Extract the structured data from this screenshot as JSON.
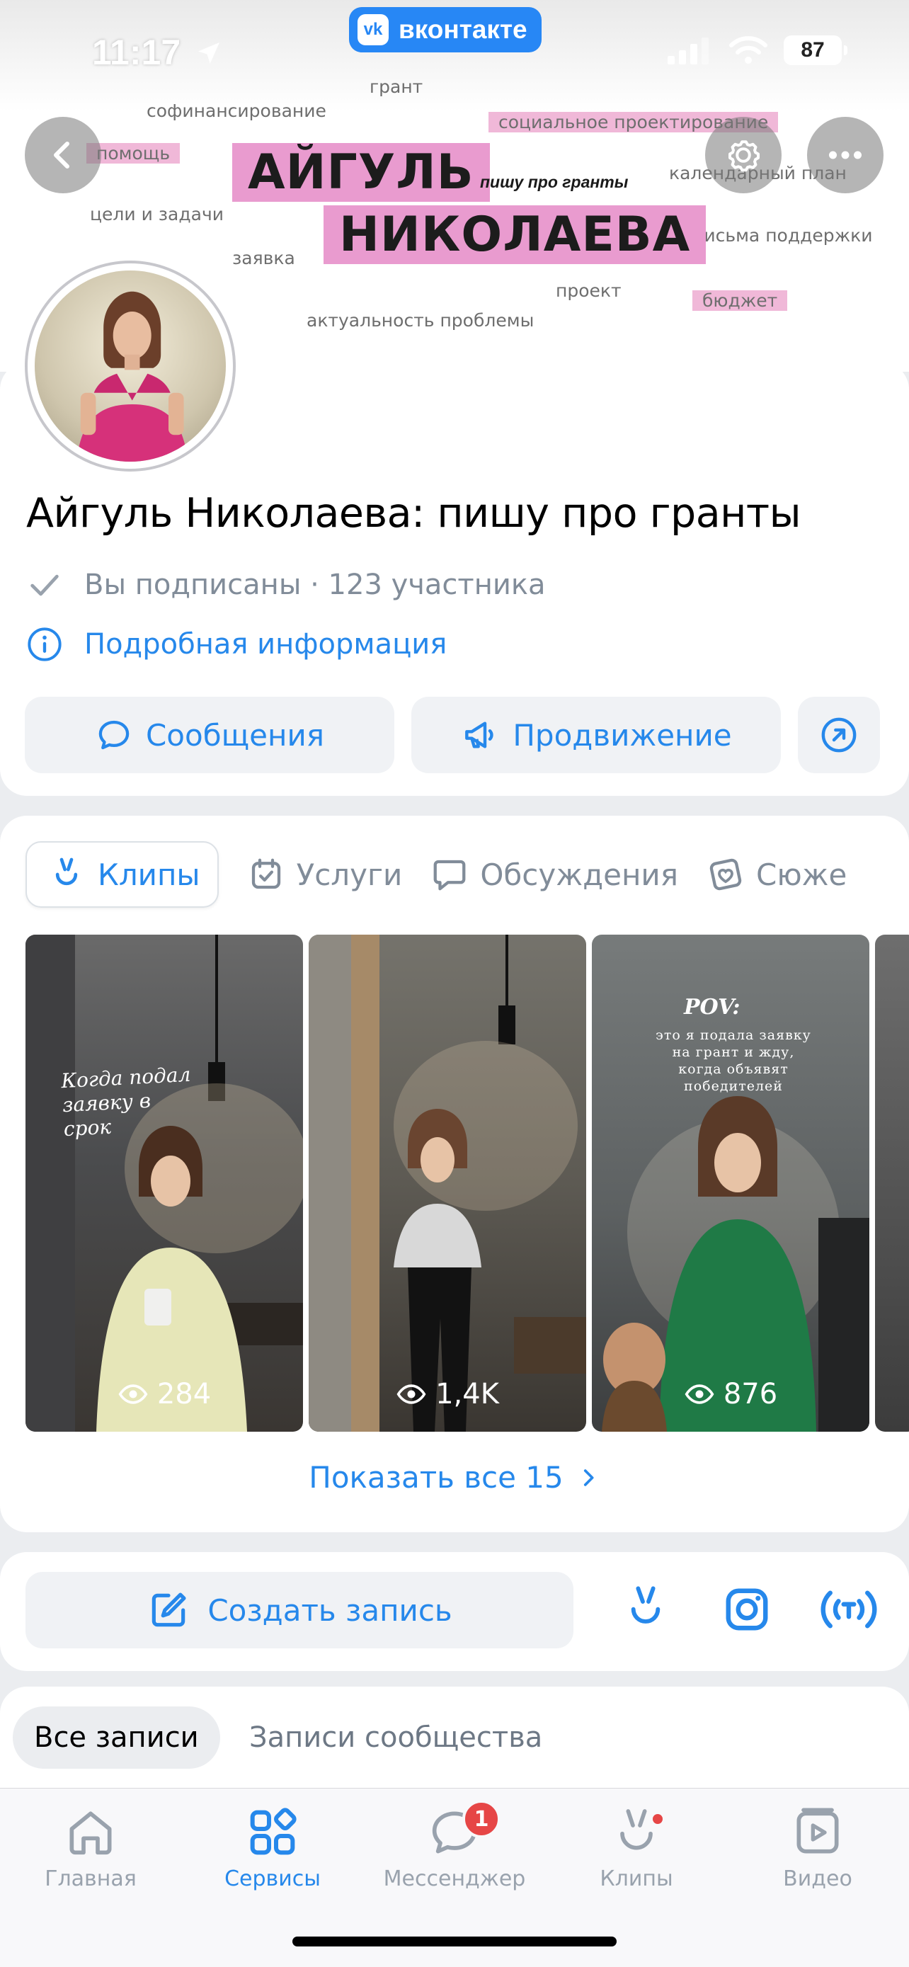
{
  "status_bar": {
    "time": "11:17",
    "app_pill": "вконтакте",
    "battery": "87"
  },
  "cover": {
    "words": {
      "grant": "грант",
      "cofinancing": "софинансирование",
      "social_design": "социальное проектирование",
      "help": "помощь",
      "goals": "цели и задачи",
      "application": "заявка",
      "calendar_plan": "календарный план",
      "support_letters": "письма поддержки",
      "project": "проект",
      "budget": "бюджет",
      "relevance": "актуальность проблемы"
    },
    "name_line1": "АЙГУЛЬ",
    "name_line2": "НИКОЛАЕВА",
    "tagline": "пишу про гранты"
  },
  "profile": {
    "title": "Айгуль Николаева: пишу про гранты",
    "subscription": "Вы подписаны · 123 участника",
    "details_link": "Подробная информация",
    "actions": {
      "messages": "Сообщения",
      "promotion": "Продвижение"
    }
  },
  "content_tabs": [
    {
      "label": "Клипы",
      "icon": "clips-icon"
    },
    {
      "label": "Услуги",
      "icon": "services-icon"
    },
    {
      "label": "Обсуждения",
      "icon": "discussions-icon"
    },
    {
      "label": "Сюже",
      "icon": "stories-icon"
    }
  ],
  "clips": [
    {
      "views": "284",
      "caption": "Когда подал заявку в срок"
    },
    {
      "views": "1,4K",
      "caption": ""
    },
    {
      "views": "876",
      "caption_title": "POV:",
      "caption": "это я подала заявку на грант и жду, когда объявят победителей"
    }
  ],
  "show_all": "Показать все 15",
  "create_post": "Создать запись",
  "post_tabs": {
    "all": "Все записи",
    "community": "Записи сообщества"
  },
  "tabbar": {
    "home": "Главная",
    "services": "Сервисы",
    "messenger": "Мессенджер",
    "messenger_badge": "1",
    "clips": "Клипы",
    "video": "Видео"
  },
  "colors": {
    "accent": "#2688eb",
    "pink": "#e99bcf",
    "badge": "#e64646"
  }
}
